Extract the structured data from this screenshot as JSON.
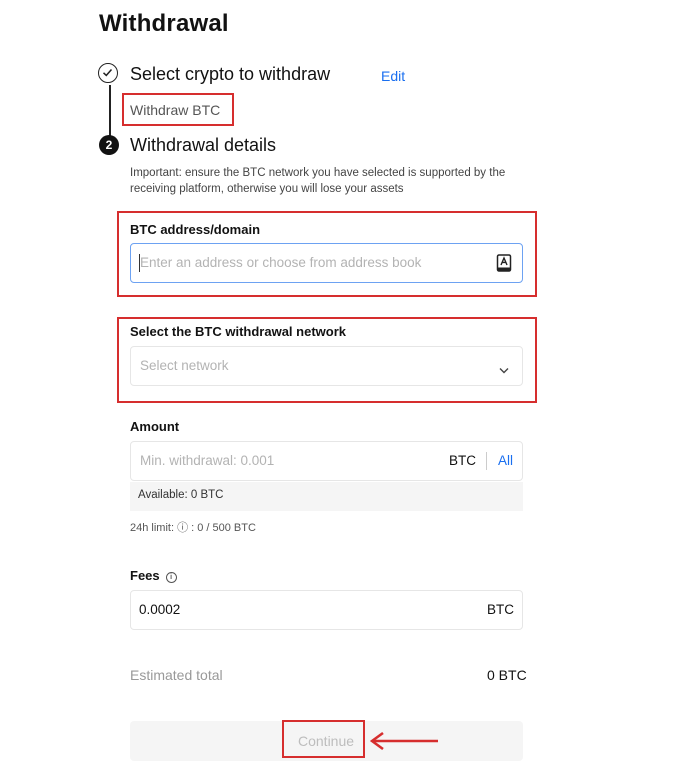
{
  "page": {
    "title": "Withdrawal"
  },
  "step1": {
    "title": "Select crypto to withdraw",
    "edit_label": "Edit",
    "selected_value": "Withdraw BTC"
  },
  "step2": {
    "number": "2",
    "title": "Withdrawal details",
    "notice": "Important: ensure the BTC network you have selected is supported by the receiving platform, otherwise you will lose your assets"
  },
  "address": {
    "label": "BTC address/domain",
    "placeholder": "Enter an address or choose from address book",
    "icon": "address-book-icon"
  },
  "network": {
    "label": "Select the BTC withdrawal network",
    "placeholder": "Select network"
  },
  "amount": {
    "label": "Amount",
    "placeholder": "Min. withdrawal: 0.001",
    "unit": "BTC",
    "all_label": "All",
    "available": "Available:  0 BTC",
    "limit": "24h limit: ⓘ : 0 / 500 BTC"
  },
  "fees": {
    "label": "Fees",
    "value": "0.0002",
    "unit": "BTC"
  },
  "total": {
    "label": "Estimated total",
    "value": "0 BTC"
  },
  "continue_label": "Continue",
  "colors": {
    "accent": "#1a6ff0",
    "highlight": "#d62e2e",
    "text": "#121212"
  }
}
